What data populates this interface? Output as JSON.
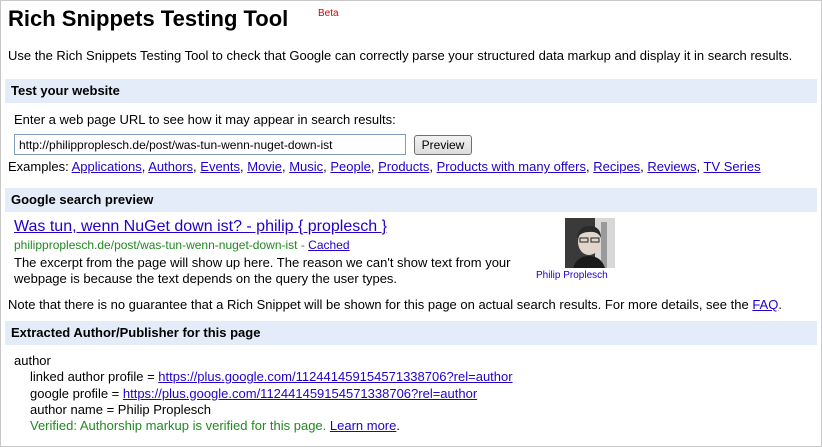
{
  "header": {
    "title": "Rich Snippets Testing Tool",
    "beta": "Beta",
    "intro": "Use the Rich Snippets Testing Tool to check that Google can correctly parse your structured data markup and display it in search results."
  },
  "test_section": {
    "heading": "Test your website",
    "prompt": "Enter a web page URL to see how it may appear in search results:",
    "url_value": "http://philipproplesch.de/post/was-tun-wenn-nuget-down-ist",
    "preview_button": "Preview",
    "examples_label": "Examples:",
    "examples": [
      "Applications",
      "Authors",
      "Events",
      "Movie",
      "Music",
      "People",
      "Products",
      "Products with many offers",
      "Recipes",
      "Reviews",
      "TV Series"
    ]
  },
  "preview_section": {
    "heading": "Google search preview",
    "result_title": "Was tun, wenn NuGet down ist? - philip { proplesch }",
    "result_url": "philipproplesch.de/post/was-tun-wenn-nuget-down-ist",
    "separator": " - ",
    "cached": "Cached",
    "snippet": "The excerpt from the page will show up here. The reason we can't show text from your webpage is because the text depends on the query the user types.",
    "author_name": "Philip Proplesch"
  },
  "note": {
    "text": "Note that there is no guarantee that a Rich Snippet will be shown for this page on actual search results. For more details, see the ",
    "faq": "FAQ",
    "end": "."
  },
  "extracted_section": {
    "heading": "Extracted Author/Publisher for this page",
    "item_type": "author",
    "linked_author_label": "linked author profile = ",
    "linked_author_url": "https://plus.google.com/112441459154571338706?rel=author",
    "google_profile_label": "google profile = ",
    "google_profile_url": "https://plus.google.com/112441459154571338706?rel=author",
    "author_name_line": "author name = Philip Proplesch",
    "verified": "Verified: Authorship markup is verified for this page.",
    "learn_more": "Learn more",
    "end": "."
  },
  "colors": {
    "section_bg": "#e5ecf9",
    "link": "#2200cc",
    "green": "#228822",
    "beta": "#dd0000"
  }
}
